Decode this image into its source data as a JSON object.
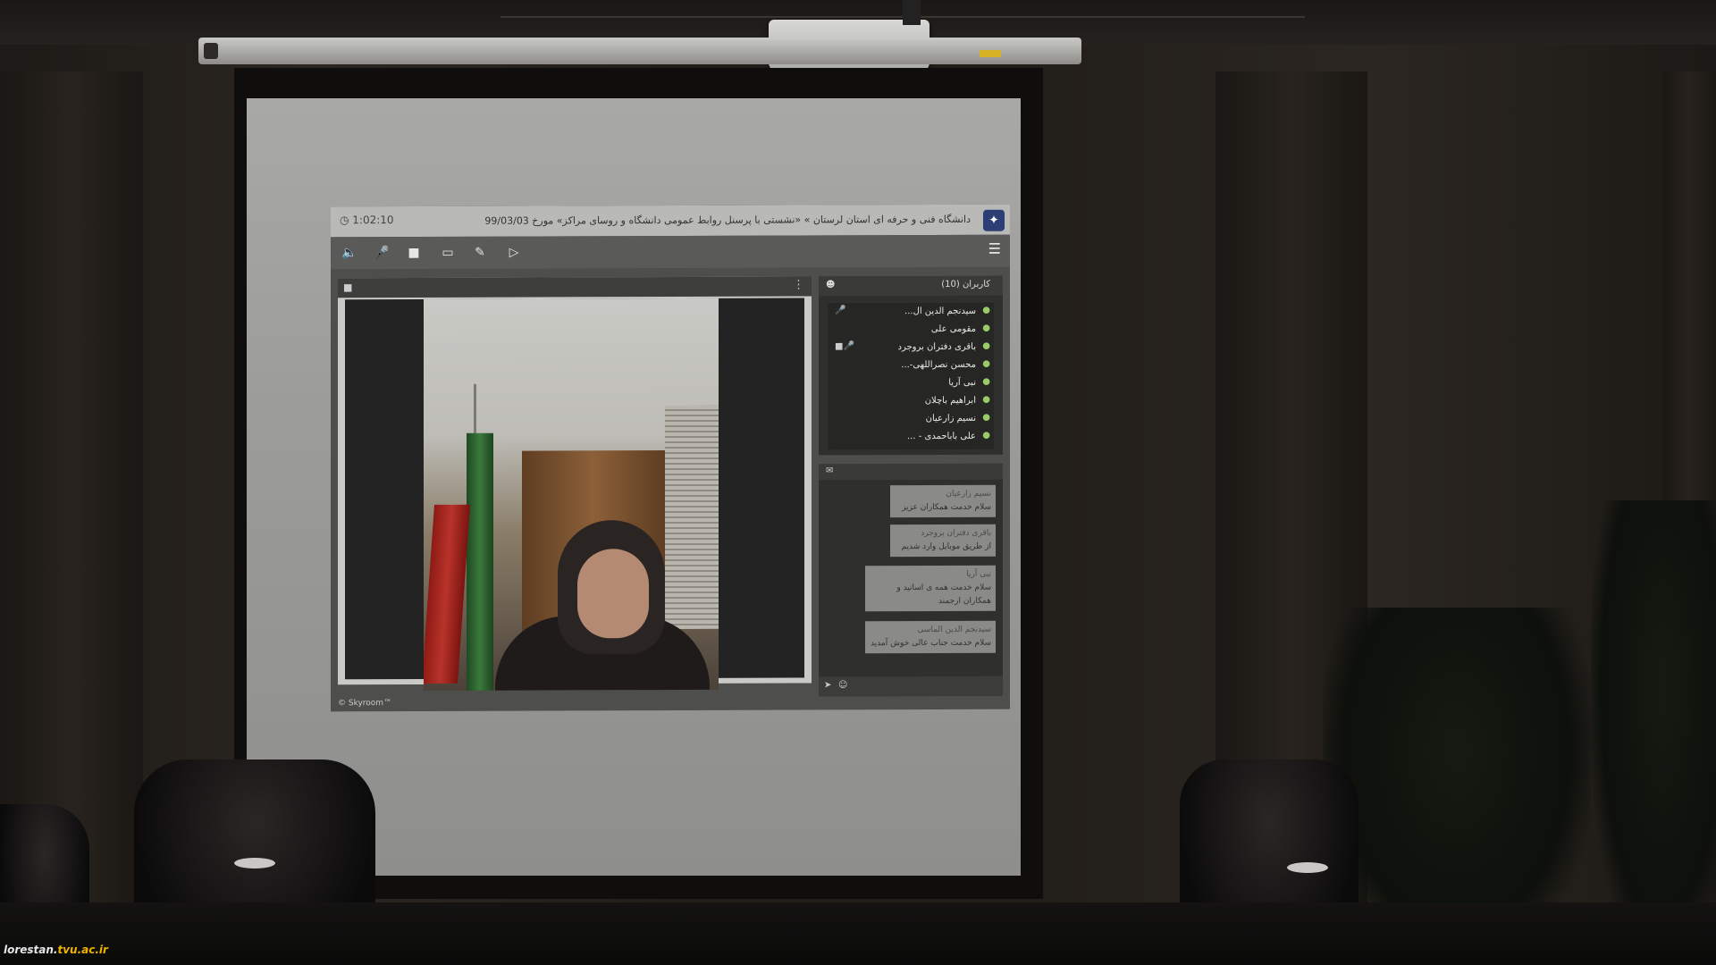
{
  "app": {
    "timer": "1:02:10",
    "title": "دانشگاه فنی و حرفه ای استان لرستان » «نشستی با پرسنل روابط عمومی دانشگاه و روسای مراکز» مورخ 99/03/03",
    "footer": "© Skyroom™"
  },
  "toolbar": {
    "icons": [
      "speaker-icon",
      "mic-muted-icon",
      "camera-icon",
      "screen-share-icon",
      "pen-icon",
      "present-icon"
    ]
  },
  "users": {
    "header": "کاربران (10)",
    "list": [
      "سیدنجم الدین ال...",
      "مقومی علی",
      "باقری دفتران بروجرد",
      "محسن نصراللهی-...",
      "نبی آریا",
      "ابراهیم باچلان",
      "نسیم زارعیان",
      "علی باباحمدی - ..."
    ]
  },
  "chat": {
    "messages": [
      {
        "from": "نسیم زارعیان",
        "text": "سلام خدمت همکاران عزیز"
      },
      {
        "from": "باقری دفتران بروجرد",
        "text": "از طریق موبایل وارد شدیم"
      },
      {
        "from": "نبی آریا",
        "text": "سلام خدمت همه ی اساتید و همکاران ارجمند"
      },
      {
        "from": "سیدنجم الدین الماسی",
        "text": "سلام خدمت جناب عالی خوش آمدید"
      }
    ]
  },
  "watermark": {
    "left": "lorestan.",
    "accent": "tvu.ac.ir"
  }
}
